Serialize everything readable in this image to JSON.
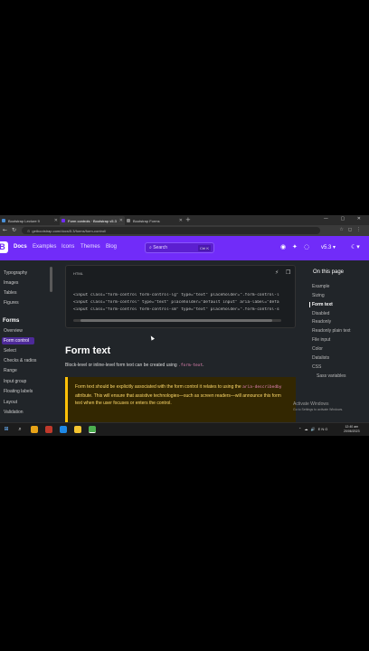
{
  "browser": {
    "tabs": [
      {
        "label": "Bootstrap Lecture 9",
        "active": false
      },
      {
        "label": "Form controls · Bootstrap v5.3",
        "active": true
      },
      {
        "label": "Bootstrap Forms",
        "active": false
      }
    ],
    "new_tab_glyph": "+",
    "window_controls": "—  ▢  ✕",
    "url": "getbootstrap.com/docs/5.3/forms/form-control/"
  },
  "navbar": {
    "brand_glyph": "B",
    "links": [
      "Docs",
      "Examples",
      "Icons",
      "Themes",
      "Blog"
    ],
    "search_placeholder": "Search",
    "search_shortcut": "Ctrl K",
    "version": "v5.3",
    "icons": [
      "github-icon",
      "twitter-icon",
      "opencollective-icon",
      "theme-toggle-icon"
    ]
  },
  "sidebar": {
    "items_top": [
      "Typography",
      "Images",
      "Tables",
      "Figures"
    ],
    "section": "Forms",
    "items": [
      "Overview",
      "Form control",
      "Select",
      "Checks & radios",
      "Range",
      "Input group",
      "Floating labels",
      "Layout",
      "Validation"
    ],
    "active_index": 1
  },
  "code": {
    "lang": "HTML",
    "lines": [
      "<input class=\"form-control form-control-lg\" type=\"text\" placeholder=\".form-control-lg\" aria-label=\".form-control-lg example\">",
      "<input class=\"form-control\" type=\"text\" placeholder=\"Default input\" aria-label=\"default input example\">",
      "<input class=\"form-control form-control-sm\" type=\"text\" placeholder=\".form-control-sm\" aria-label=\".form-control-sm example\">"
    ]
  },
  "main": {
    "heading": "Form text",
    "para_prefix": "Block-level or inline-level form text can be created using",
    "para_code": ".form-text",
    "para_suffix": ".",
    "callout_part1": "Form text should be explicitly associated with the form control it relates to using the",
    "callout_code": "aria-describedby",
    "callout_part2": "attribute. This will ensure that assistive technologies—such as screen readers—will announce this form text when the user focuses or enters the control."
  },
  "toc": {
    "title": "On this page",
    "items": [
      "Example",
      "Sizing",
      "Form text",
      "Disabled",
      "Readonly",
      "Readonly plain text",
      "File input",
      "Color",
      "Datalists",
      "CSS"
    ],
    "sub_items": [
      "Sass variables"
    ],
    "active_index": 2
  },
  "watermark": {
    "title": "Activate Windows",
    "subtitle": "Go to Settings to activate Windows."
  },
  "taskbar": {
    "tray": "⌃  ☁  🔊  ENG",
    "time": "12:40 am",
    "date": "20/06/2023"
  },
  "colors": {
    "brand": "#712cf9",
    "callout_border": "#ffc107",
    "callout_text": "#ffda6a",
    "code_inline": "#e685b5"
  }
}
